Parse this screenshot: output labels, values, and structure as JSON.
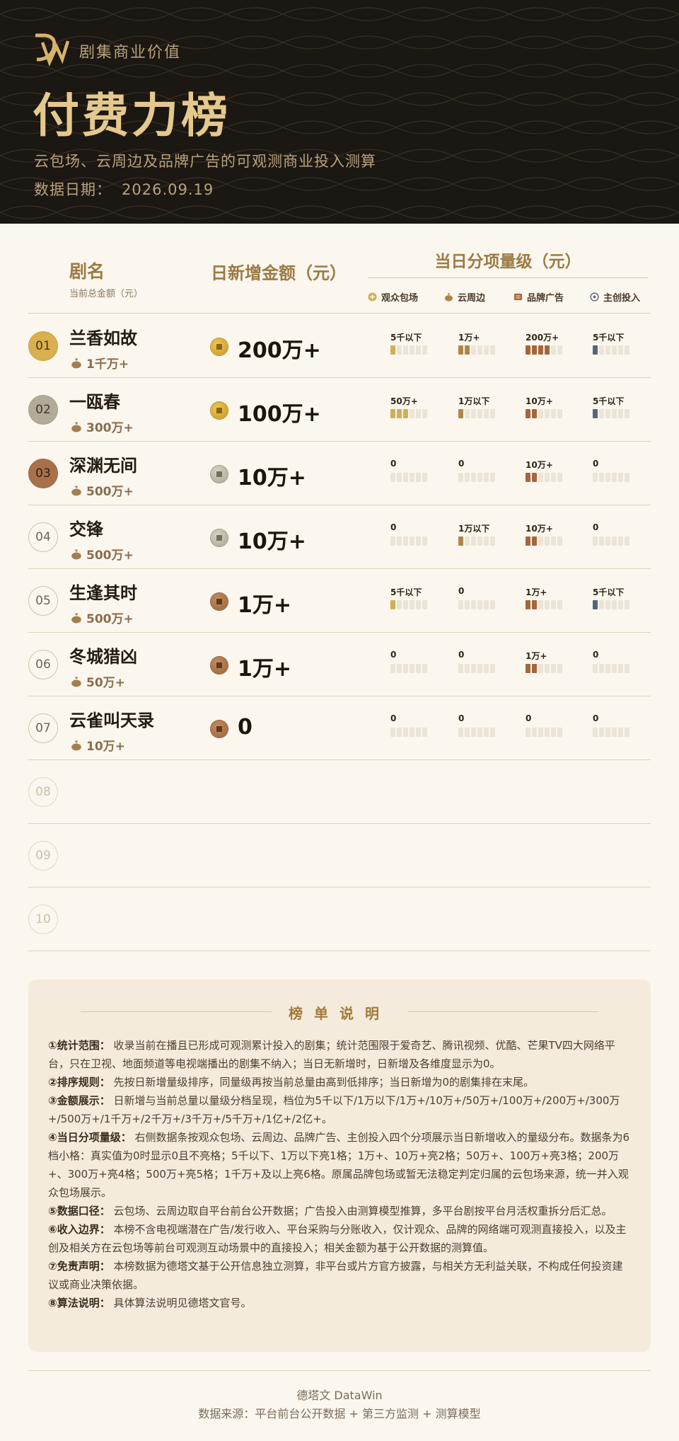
{
  "header": {
    "brand": "剧集商业价值",
    "title": "付费力榜",
    "subtitle": "云包场、云周边及品牌广告的可观测商业投入测算",
    "date_label": "数据日期：",
    "date_value": "2026.09.19"
  },
  "columns": {
    "name": "剧名",
    "name_sub": "当前总金额（元）",
    "amount": "日新增金额（元）",
    "split": "当日分项量级（元）",
    "legend": [
      {
        "label": "观众包场",
        "icon": "plus-coin-icon",
        "color": "#d2ae55"
      },
      {
        "label": "云周边",
        "icon": "money-bag-icon",
        "color": "#b08648"
      },
      {
        "label": "品牌广告",
        "icon": "billboard-icon",
        "color": "#a5663c"
      },
      {
        "label": "主创投入",
        "icon": "target-icon",
        "color": "#55657f"
      }
    ]
  },
  "rows": [
    {
      "rank": "01",
      "name": "兰香如故",
      "total": "1千万+",
      "amount": "200万+",
      "coin": "gold",
      "segments": [
        {
          "label": "5千以下",
          "level": 1
        },
        {
          "label": "1万+",
          "level": 2
        },
        {
          "label": "200万+",
          "level": 4
        },
        {
          "label": "5千以下",
          "level": 1
        }
      ]
    },
    {
      "rank": "02",
      "name": "一瓯春",
      "total": "300万+",
      "amount": "100万+",
      "coin": "gold",
      "segments": [
        {
          "label": "50万+",
          "level": 3
        },
        {
          "label": "1万以下",
          "level": 1
        },
        {
          "label": "10万+",
          "level": 2
        },
        {
          "label": "5千以下",
          "level": 1
        }
      ]
    },
    {
      "rank": "03",
      "name": "深渊无间",
      "total": "500万+",
      "amount": "10万+",
      "coin": "silver",
      "segments": [
        {
          "label": "0",
          "level": 0
        },
        {
          "label": "0",
          "level": 0
        },
        {
          "label": "10万+",
          "level": 2
        },
        {
          "label": "0",
          "level": 0
        }
      ]
    },
    {
      "rank": "04",
      "name": "交锋",
      "total": "500万+",
      "amount": "10万+",
      "coin": "silver",
      "segments": [
        {
          "label": "0",
          "level": 0
        },
        {
          "label": "1万以下",
          "level": 1
        },
        {
          "label": "10万+",
          "level": 2
        },
        {
          "label": "0",
          "level": 0
        }
      ]
    },
    {
      "rank": "05",
      "name": "生逢其时",
      "total": "500万+",
      "amount": "1万+",
      "coin": "bronze",
      "segments": [
        {
          "label": "5千以下",
          "level": 1
        },
        {
          "label": "0",
          "level": 0
        },
        {
          "label": "1万+",
          "level": 2
        },
        {
          "label": "5千以下",
          "level": 1
        }
      ]
    },
    {
      "rank": "06",
      "name": "冬城猎凶",
      "total": "50万+",
      "amount": "1万+",
      "coin": "bronze",
      "segments": [
        {
          "label": "0",
          "level": 0
        },
        {
          "label": "0",
          "level": 0
        },
        {
          "label": "1万+",
          "level": 2
        },
        {
          "label": "0",
          "level": 0
        }
      ]
    },
    {
      "rank": "07",
      "name": "云雀叫天录",
      "total": "10万+",
      "amount": "0",
      "coin": "bronze",
      "segments": [
        {
          "label": "0",
          "level": 0
        },
        {
          "label": "0",
          "level": 0
        },
        {
          "label": "0",
          "level": 0
        },
        {
          "label": "0",
          "level": 0
        }
      ]
    },
    {
      "rank": "08"
    },
    {
      "rank": "09"
    },
    {
      "rank": "10"
    }
  ],
  "notes": {
    "title": "榜单说明",
    "items": [
      {
        "head": "①统计范围：",
        "text": "收录当前在播且已形成可观测累计投入的剧集；统计范围限于爱奇艺、腾讯视频、优酷、芒果TV四大网络平台，只在卫视、地面频道等电视端播出的剧集不纳入；当日无新增时，日新增及各维度显示为0。"
      },
      {
        "head": "②排序规则：",
        "text": "先按日新增量级排序，同量级再按当前总量由高到低排序；当日新增为0的剧集排在末尾。"
      },
      {
        "head": "③金额展示：",
        "text": "日新增与当前总量以量级分档呈现，档位为5千以下/1万以下/1万+/10万+/50万+/100万+/200万+/300万+/500万+/1千万+/2千万+/3千万+/5千万+/1亿+/2亿+。"
      },
      {
        "head": "④当日分项量级：",
        "text": "右侧数据条按观众包场、云周边、品牌广告、主创投入四个分项展示当日新增收入的量级分布。数据条为6档小格：真实值为0时显示0且不亮格；5千以下、1万以下亮1格；1万+、10万+亮2格；50万+、100万+亮3格；200万+、300万+亮4格；500万+亮5格；1千万+及以上亮6格。原属品牌包场或暂无法稳定判定归属的云包场来源，统一并入观众包场展示。"
      },
      {
        "head": "⑤数据口径：",
        "text": "云包场、云周边取自平台前台公开数据；广告投入由测算模型推算，多平台剧按平台月活权重拆分后汇总。"
      },
      {
        "head": "⑥收入边界：",
        "text": "本榜不含电视端潜在广告/发行收入、平台采购与分账收入，仅计观众、品牌的网络端可观测直接投入，以及主创及相关方在云包场等前台可观测互动场景中的直接投入；相关金额为基于公开数据的测算值。"
      },
      {
        "head": "⑦免责声明：",
        "text": "本榜数据为德塔文基于公开信息独立测算，非平台或片方官方披露，与相关方无利益关联，不构成任何投资建议或商业决策依据。"
      },
      {
        "head": "⑧算法说明：",
        "text": "具体算法说明见德塔文官号。"
      }
    ]
  },
  "footer": {
    "line1": "德塔文 DataWin",
    "line2": "数据来源：平台前台公开数据 + 第三方监测 + 测算模型"
  },
  "colors": {
    "gold": "#e5c88e",
    "seg_audience": "#d2ae55",
    "seg_merch": "#b08648",
    "seg_brand": "#a5663c",
    "seg_creator": "#55657f",
    "seg_off": "#ebe4d7"
  }
}
